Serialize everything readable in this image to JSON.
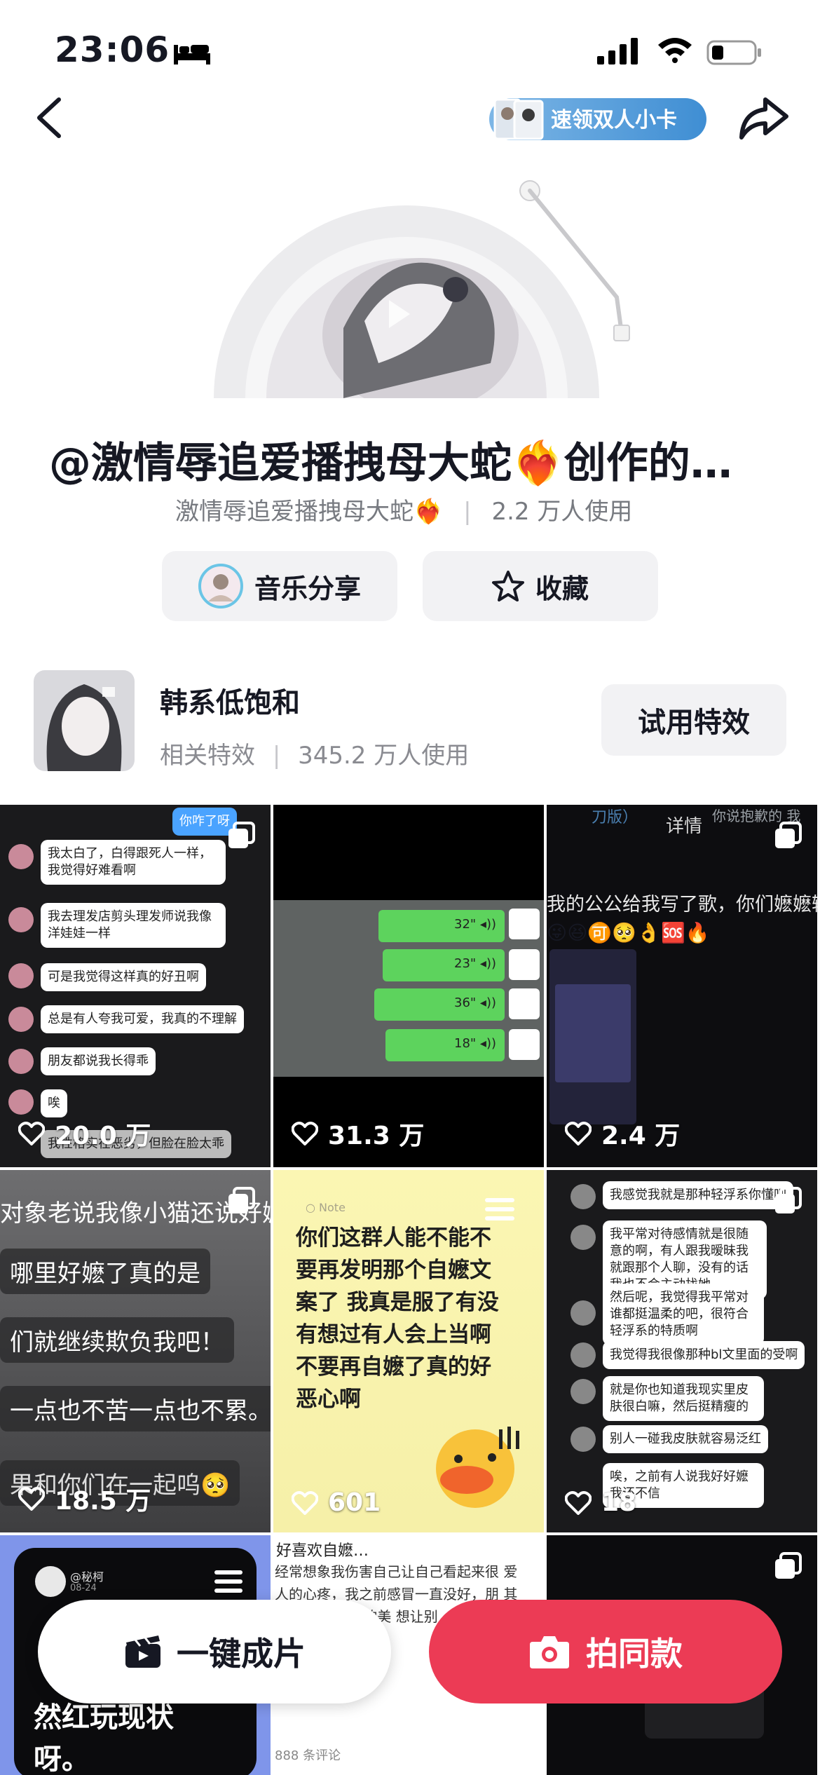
{
  "status_bar": {
    "time": "23:06"
  },
  "nav": {
    "chip_label": "速领双人小卡"
  },
  "music": {
    "title": "@激情辱追爱播拽母大蛇❤️‍🔥创作的…",
    "author": "激情辱追爱播拽母大蛇❤️‍🔥",
    "separator": "|",
    "usage": "2.2 万人使用",
    "share_label": "音乐分享",
    "favorite_label": "收藏"
  },
  "related_effect": {
    "name": "韩系低饱和",
    "type_label": "相关特效",
    "separator": "|",
    "usage": "345.2 万人使用",
    "try_label": "试用特效"
  },
  "grid": [
    {
      "likes": "20.0 万",
      "header_bubble": "你咋了呀",
      "messages": [
        "我太白了，白得跟死人一样，我觉得好难看啊",
        "我去理发店剪头理发师说我像洋娃娃一样",
        "可是我觉得这样真的好丑啊",
        "总是有人夸我可爱，我真的不理解",
        "朋友都说我长得乖",
        "唉",
        "我性格实在恶劣，但脸在脸太乖"
      ]
    },
    {
      "likes": "31.3 万",
      "voice_durations": [
        "32\"",
        "23\"",
        "36\"",
        "18\""
      ]
    },
    {
      "likes": "2.4 万",
      "top_text": "刀版）",
      "top_right": "你说抱歉的 我",
      "header": "详情",
      "caption": "我的公公给我写了歌，你们嬷嬷输了",
      "emojis": "😜😆🉑🥺👌🆘🔥"
    },
    {
      "likes": "18.5 万",
      "lines": [
        "对象老说我像小猫还说好嬷",
        "哪里好嬷了真的是",
        "们就继续欺负我吧！",
        "一点也不苦一点也不累。",
        "果和你们在一起呜🥺"
      ]
    },
    {
      "likes": "601",
      "note_label": "Note",
      "note_text": "你们这群人能不能不要再发明那个自嬷文案了 我真是服了有没有想过有人会上当啊不要再自嬷了真的好恶心啊"
    },
    {
      "likes": "18",
      "messages": [
        "我感觉我就是那种轻浮系你懂吧",
        "我平常对待感情就是很随意的啊，有人跟我暧昧我就跟那个人聊，没有的话我也不会主动找她",
        "然后呢，我觉得我平常对谁都挺温柔的吧，很符合轻浮系的特质啊",
        "我觉得我很像那种bl文里面的受啊",
        "就是你也知道我现实里皮肤很白嘛，然后挺精瘦的",
        "别人一碰我皮肤就容易泛红",
        "唉，之前有人说我好好嬷我还不信"
      ]
    },
    {
      "handle": "@秘柯",
      "date": "08-24",
      "text": "然红玩现状呀。"
    },
    {
      "header": "好喜欢自嬷…",
      "body": "经常想象我伤害自己让自己看起来很 爱人的心疼，我之前感冒一直没好，朋 其实我听到 决死的美 想让别",
      "comments": "888 条评论"
    },
    {}
  ],
  "bottom": {
    "one_click_label": "一键成片",
    "shoot_label": "拍同款"
  },
  "colors": {
    "accent_red": "#ec3b55",
    "chip_blue": "#3f8ed3",
    "wechat_green": "#5dd35d"
  }
}
